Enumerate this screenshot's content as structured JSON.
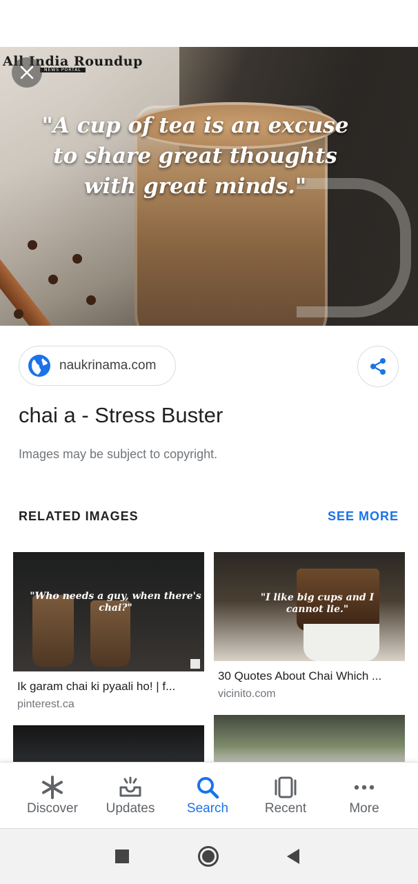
{
  "hero": {
    "logo_text": "All India Roundup",
    "logo_sub": "NEWS PORTAL",
    "quote": "\"A cup of tea is an excuse to share great thoughts with great minds.\""
  },
  "source": {
    "domain": "naukrinama.com",
    "icon": "globe-icon"
  },
  "result": {
    "title": "chai a - Stress Buster",
    "copyright": "Images may be subject to copyright."
  },
  "related": {
    "heading": "RELATED IMAGES",
    "see_more": "SEE MORE",
    "items": [
      {
        "image_text": "\"Who needs a guy, when there's chai?\"",
        "caption": "Ik garam chai ki pyaali ho! | f...",
        "source": "pinterest.ca"
      },
      {
        "image_text": "\"I like big cups and I cannot lie.\"",
        "caption": "30 Quotes About Chai Which ...",
        "source": "vicinito.com"
      }
    ]
  },
  "bottom_nav": {
    "items": [
      {
        "label": "Discover",
        "icon": "asterisk-icon"
      },
      {
        "label": "Updates",
        "icon": "inbox-icon"
      },
      {
        "label": "Search",
        "icon": "search-icon"
      },
      {
        "label": "Recent",
        "icon": "recent-tabs-icon"
      },
      {
        "label": "More",
        "icon": "more-dots-icon"
      }
    ],
    "active": "Search"
  },
  "colors": {
    "accent": "#1a73e8",
    "text_primary": "#202124",
    "text_secondary": "#70757a"
  }
}
